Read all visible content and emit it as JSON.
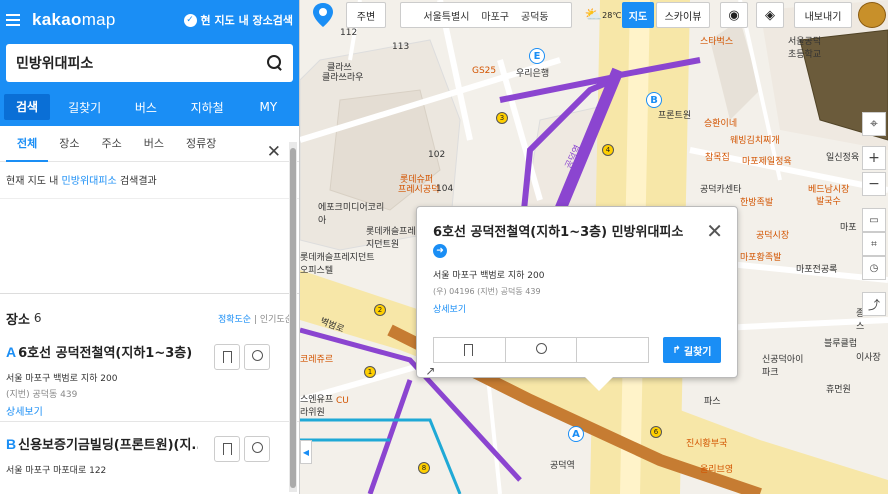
{
  "header": {
    "brand_bold": "kakao",
    "brand_light": "map",
    "with_map_label": "현 지도 내 장소검색"
  },
  "search": {
    "value": "민방위대피소",
    "placeholder": ""
  },
  "nav_tabs": [
    {
      "label": "검색"
    },
    {
      "label": "길찾기"
    },
    {
      "label": "버스"
    },
    {
      "label": "지하철"
    },
    {
      "label": "MY"
    }
  ],
  "sub_tabs": [
    {
      "label": "전체"
    },
    {
      "label": "장소"
    },
    {
      "label": "주소"
    },
    {
      "label": "버스"
    },
    {
      "label": "정류장"
    }
  ],
  "result_note": {
    "prefix": "현재 지도 내",
    "query": "민방위대피소",
    "suffix": "검색결과"
  },
  "places": {
    "title": "장소",
    "count": "6",
    "sort_accuracy": "정확도순",
    "sort_popular": "인기도순",
    "items": [
      {
        "letter": "A",
        "name": "6호선 공덕전철역(지하1~3층) ...",
        "address": "서울 마포구 백범로 지하 200",
        "jibun": "(지번) 공덕동 439",
        "detail": "상세보기"
      },
      {
        "letter": "B",
        "name": "신용보증기금빌딩(프론트원)(지...",
        "address": "서울 마포구 마포대로 122",
        "jibun": "",
        "detail": ""
      }
    ]
  },
  "toolbar": {
    "nearby": "주변",
    "loc1": "서울특별시",
    "loc2": "마포구",
    "loc3": "공덕동",
    "temp": "28℃",
    "map_btn": "지도",
    "skyview": "스카이뷰",
    "export": "내보내기"
  },
  "popup": {
    "title": "6호선 공덕전철역(지하1~3층) 민방위대피소",
    "address": "서울 마포구 백범로 지하 200",
    "jibun": "(우) 04196  (지번) 공덕동 439",
    "detail": "상세보기",
    "route": "길찾기"
  },
  "map_labels": [
    {
      "text": "클라쓰",
      "cls": "dk"
    },
    {
      "text": "클라쓰라우",
      "cls": "dk"
    },
    {
      "text": "GS25",
      "cls": "or"
    },
    {
      "text": "우리은행",
      "cls": "dk"
    },
    {
      "text": "프론트원",
      "cls": "dk"
    },
    {
      "text": "스타벅스",
      "cls": "or"
    },
    {
      "text": "서울공덕초등학교",
      "cls": "dk"
    },
    {
      "text": "승환이네",
      "cls": "or"
    },
    {
      "text": "웨빙김치찌개",
      "cls": "or"
    },
    {
      "text": "참목집",
      "cls": "or"
    },
    {
      "text": "마포제일정육",
      "cls": "or"
    },
    {
      "text": "일신정육",
      "cls": "dk"
    },
    {
      "text": "공덕역",
      "cls": "dk"
    },
    {
      "text": "롯데슈퍼",
      "cls": "or"
    },
    {
      "text": "프레시공덕",
      "cls": "or"
    },
    {
      "text": "공덕카센타",
      "cls": "dk"
    },
    {
      "text": "한방족발",
      "cls": "or"
    },
    {
      "text": "베드남시장",
      "cls": "or"
    },
    {
      "text": "발국수",
      "cls": "or"
    },
    {
      "text": "에포크미디어코리아",
      "cls": "dk"
    },
    {
      "text": "롯데캐슬프레지던트원",
      "cls": "dk"
    },
    {
      "text": "롯데캐슬프레지던트오피스텔",
      "cls": "dk"
    },
    {
      "text": "공덕시장",
      "cls": "or"
    },
    {
      "text": "마포황족발",
      "cls": "or"
    },
    {
      "text": "마포전공록",
      "cls": "dk"
    },
    {
      "text": "마포",
      "cls": "dk"
    },
    {
      "text": "벽범로",
      "cls": "dk"
    },
    {
      "text": "코레쥬르",
      "cls": "or"
    },
    {
      "text": "스엔유프라위원",
      "cls": "dk"
    },
    {
      "text": "CU",
      "cls": "or"
    },
    {
      "text": "신공덕아이파크",
      "cls": "dk"
    },
    {
      "text": "휴먼원",
      "cls": "dk"
    },
    {
      "text": "블루클럽",
      "cls": "dk"
    },
    {
      "text": "진시황부국",
      "cls": "or"
    },
    {
      "text": "올리브영",
      "cls": "or"
    },
    {
      "text": "공덕역",
      "cls": "dk"
    },
    {
      "text": "파스",
      "cls": "dk"
    },
    {
      "text": "종보프스",
      "cls": "dk"
    },
    {
      "text": "이사장",
      "cls": "dk"
    },
    {
      "text": "102",
      "cls": "dk"
    },
    {
      "text": "112",
      "cls": "dk"
    },
    {
      "text": "113",
      "cls": "dk"
    },
    {
      "text": "104",
      "cls": "dk"
    }
  ],
  "colors": {
    "accent": "#1a8ef5",
    "line6": "#c67c32",
    "line5": "#8b45d0",
    "line_blue": "#1fa9d6"
  }
}
